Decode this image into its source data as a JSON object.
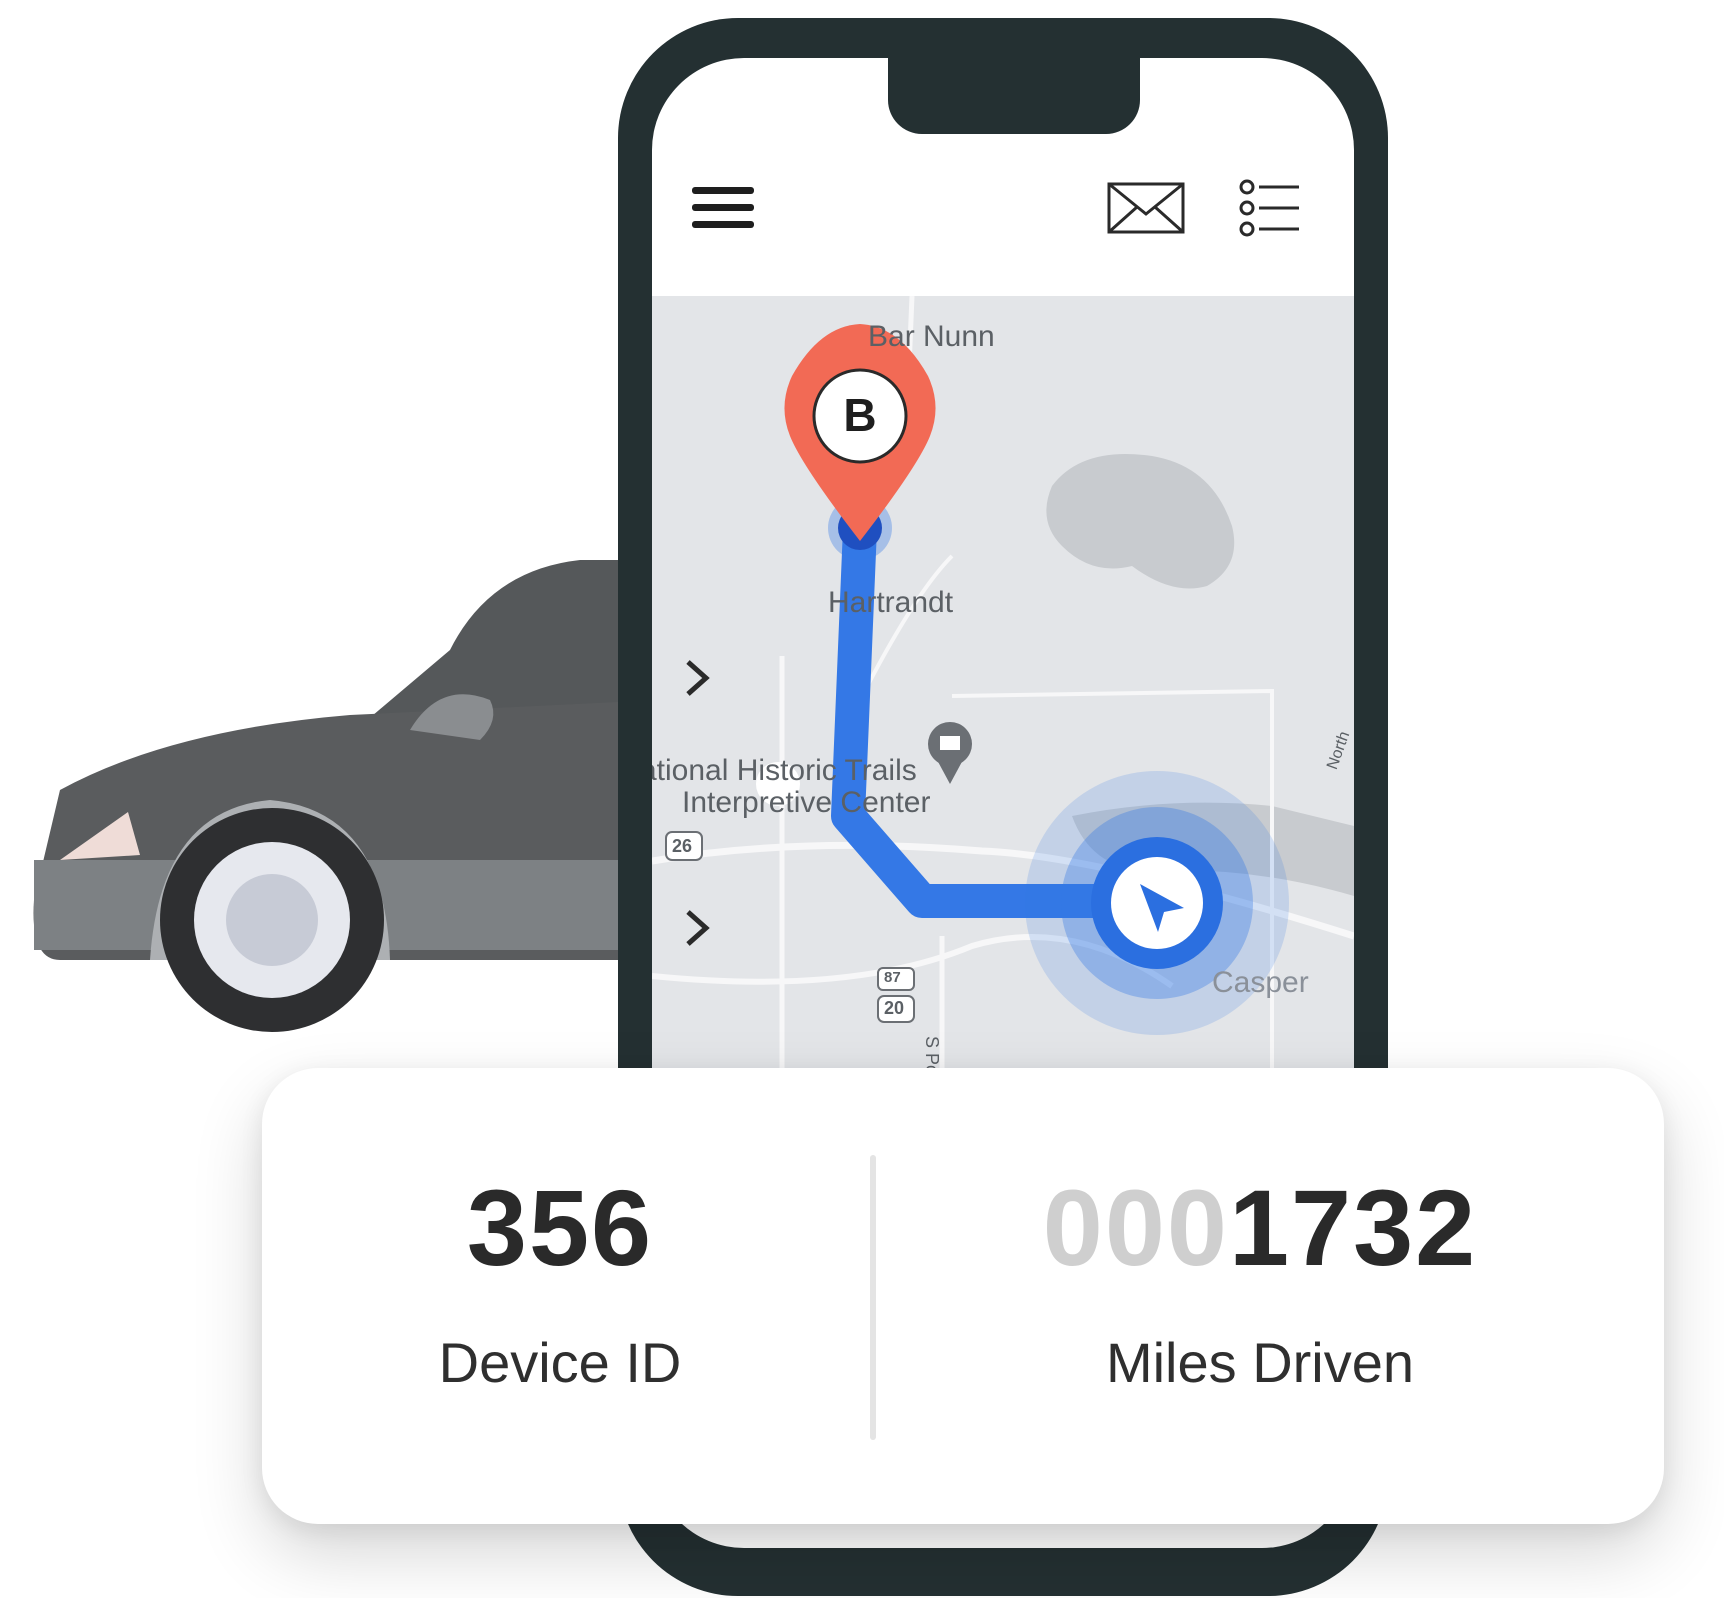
{
  "colors": {
    "phone_frame": "#243032",
    "route": "#3478e6",
    "pin": "#f26a55",
    "map_bg": "#e3e5e8",
    "car_body": "#5a5c5e"
  },
  "icons": {
    "menu": "hamburger-menu-icon",
    "mail": "envelope-icon",
    "list": "list-icon",
    "destination": "map-pin-icon",
    "navigation": "navigation-arrow-icon",
    "museum": "museum-icon"
  },
  "map": {
    "destination_marker_letter": "B",
    "labels": {
      "town_north": "Bar Nunn",
      "town_mid": "Hartrandt",
      "poi_line1": "ational Historic Trails",
      "poi_line2": "Interpretive Center",
      "city": "Casper",
      "street": "S Poplar",
      "highway_26": "26",
      "highway_20": "20",
      "highway_87": "87",
      "north_road": "North"
    }
  },
  "stats": {
    "device_id_value": "356",
    "device_id_label": "Device ID",
    "miles_leading_zeros": "000",
    "miles_value": "1732",
    "miles_label": "Miles Driven"
  }
}
